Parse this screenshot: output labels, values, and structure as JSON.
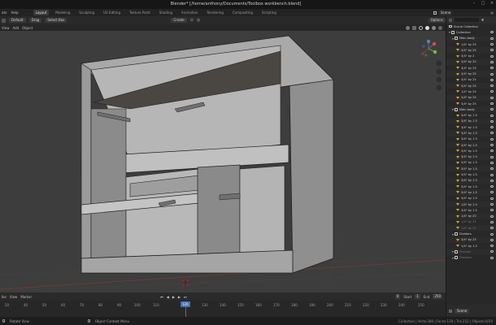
{
  "window": {
    "title": "Blender* [/home/anthony/Documents/Toolbox workbench.blend]"
  },
  "menubar": {
    "items": [
      "ate",
      "Help"
    ],
    "tabs": [
      "Layout",
      "Modeling",
      "Sculpting",
      "UV Editing",
      "Texture Paint",
      "Shading",
      "Animation",
      "Rendering",
      "Compositing",
      "Scripting"
    ],
    "active_tab": 0
  },
  "scene": {
    "label": "Scene",
    "view_layer": "View Layer"
  },
  "toolheader": {
    "orientation": "Default",
    "drag_label": "Drag",
    "select": "Select Box",
    "create": "Create",
    "options": "Options"
  },
  "viewport_header": {
    "items": [
      "View",
      "Add",
      "Object"
    ]
  },
  "timeline_header": {
    "items": [
      "Ike",
      "View",
      "Marker"
    ],
    "current_frame": "0",
    "start_label": "Start",
    "start_value": "1",
    "end_label": "End",
    "end_value": "250"
  },
  "timeline": {
    "ticks": [
      "20",
      "40",
      "50",
      "60",
      "70",
      "80",
      "90",
      "100",
      "110",
      "120",
      "130",
      "140",
      "150",
      "160",
      "170",
      "180",
      "190",
      "200",
      "210",
      "220",
      "230",
      "240",
      "250"
    ],
    "current": "120"
  },
  "statusbar": {
    "left": "Rotate View",
    "mid": "Object Context Menu",
    "right": "Collection | Verts:280 | Faces:118 | Tris:212 | Objects:0/20"
  },
  "outliner": {
    "title": "Scene Collection",
    "rows": [
      {
        "type": "coll",
        "label": "Collection",
        "depth": 0
      },
      {
        "type": "coll",
        "label": "Main body",
        "depth": 1
      },
      {
        "type": "obj",
        "label": "1/4\" by 25",
        "depth": 2
      },
      {
        "type": "obj",
        "label": "3/4\" by 25",
        "depth": 2
      },
      {
        "type": "obj",
        "label": "3/4\" by 2",
        "depth": 2
      },
      {
        "type": "obj",
        "label": "3/4\" by 25",
        "depth": 2
      },
      {
        "type": "obj",
        "label": "3/4\" by 25",
        "depth": 2
      },
      {
        "type": "obj",
        "label": "3/4\" by 25",
        "depth": 2
      },
      {
        "type": "obj",
        "label": "3/4\" by 25",
        "depth": 2
      },
      {
        "type": "obj",
        "label": "3/4\" by 25",
        "depth": 2
      },
      {
        "type": "obj",
        "label": "1/4\" by 25",
        "depth": 2
      },
      {
        "type": "obj",
        "label": "3/4\" by 25",
        "depth": 2
      },
      {
        "type": "obj",
        "label": "3/4\" by 25",
        "depth": 2
      },
      {
        "type": "coll",
        "label": "Main body",
        "depth": 1
      },
      {
        "type": "obj",
        "label": "3/4\" by 1.5",
        "depth": 2
      },
      {
        "type": "obj",
        "label": "3/4\" by 1.5",
        "depth": 2
      },
      {
        "type": "obj",
        "label": "3/4\" by 1.5",
        "depth": 2
      },
      {
        "type": "obj",
        "label": "3/4\" by 1.5",
        "depth": 2
      },
      {
        "type": "obj",
        "label": "3/4\" by 1.5",
        "depth": 2
      },
      {
        "type": "obj",
        "label": "3/4\" by 1.5",
        "depth": 2
      },
      {
        "type": "obj",
        "label": "3/4\" by 1.5",
        "depth": 2
      },
      {
        "type": "obj",
        "label": "3/4\" by 1.5",
        "depth": 2
      },
      {
        "type": "obj",
        "label": "3/4\" by 1.5",
        "depth": 2
      },
      {
        "type": "obj",
        "label": "3/4\" by 1.5",
        "depth": 2
      },
      {
        "type": "obj",
        "label": "3/4\" by 1.5",
        "depth": 2
      },
      {
        "type": "obj",
        "label": "3/4\" by 1.5",
        "depth": 2
      },
      {
        "type": "obj",
        "label": "3/4\" by 1.5",
        "depth": 2
      },
      {
        "type": "obj",
        "label": "3/4\" by 1.5",
        "depth": 2
      },
      {
        "type": "obj",
        "label": "3/4\" by 1.5",
        "depth": 2
      },
      {
        "type": "obj",
        "label": "1/4\" by 1.5",
        "depth": 2
      },
      {
        "type": "obj",
        "label": "3/4\" by 1.5",
        "depth": 2
      },
      {
        "type": "obj",
        "label": "1/4\" by 25",
        "depth": 2
      },
      {
        "type": "obj",
        "label": "1/4\" by 25",
        "depth": 2,
        "dim": true
      },
      {
        "type": "obj",
        "label": "1/4\" by 25",
        "depth": 2,
        "dim": true
      },
      {
        "type": "coll",
        "label": "Dividers",
        "depth": 1
      },
      {
        "type": "obj",
        "label": "3/4\" by 25",
        "depth": 2
      },
      {
        "type": "obj",
        "label": "1/4\" by 1.5",
        "depth": 2
      },
      {
        "type": "coll",
        "label": "Shelves",
        "depth": 1,
        "dim": true
      },
      {
        "type": "coll",
        "label": "Drawers",
        "depth": 1,
        "dim": true
      }
    ]
  },
  "properties": {
    "label": "Scene"
  },
  "colors": {
    "accent": "#4772b3",
    "object_icon": "#e39b3b",
    "viewport": "#3d3d3d"
  }
}
